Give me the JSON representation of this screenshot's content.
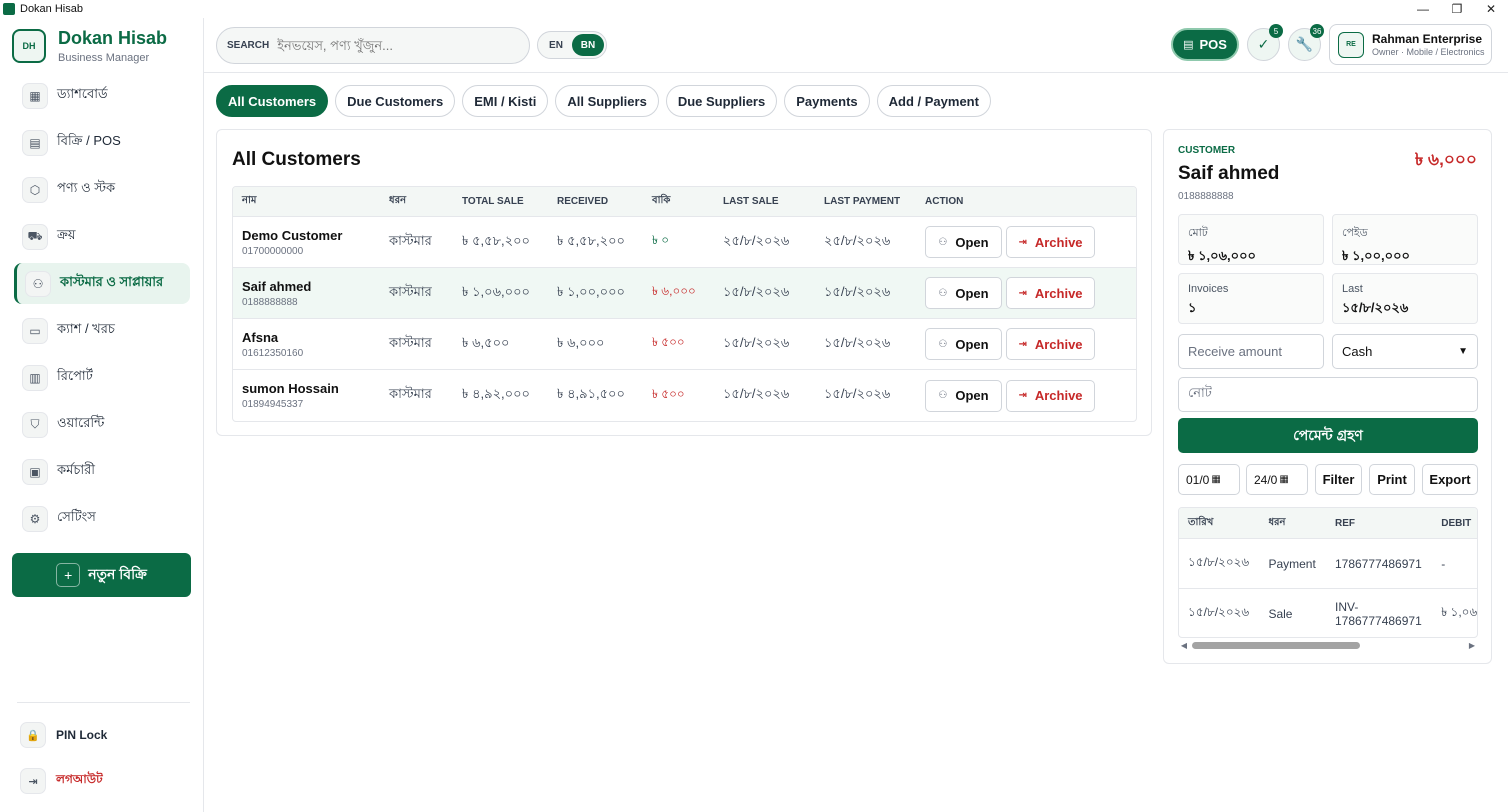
{
  "window": {
    "title": "Dokan Hisab",
    "minimize": "—",
    "maximize": "❐",
    "close": "✕"
  },
  "brand": {
    "title": "Dokan Hisab",
    "subtitle": "Business Manager",
    "logo_text": "DH"
  },
  "sidebar": {
    "items": [
      {
        "label": "ড্যাশবোর্ড",
        "icon": "dashboard-icon",
        "glyph": "▦"
      },
      {
        "label": "বিক্রি / POS",
        "icon": "receipt-icon",
        "glyph": "▤"
      },
      {
        "label": "পণ্য ও স্টক",
        "icon": "box-icon",
        "glyph": "⬡"
      },
      {
        "label": "ক্রয়",
        "icon": "truck-icon",
        "glyph": "⛟"
      },
      {
        "label": "কাস্টমার ও সাপ্লায়ার",
        "icon": "users-icon",
        "glyph": "⚇"
      },
      {
        "label": "ক্যাশ / খরচ",
        "icon": "wallet-icon",
        "glyph": "▭"
      },
      {
        "label": "রিপোর্ট",
        "icon": "bar-chart-icon",
        "glyph": "▥"
      },
      {
        "label": "ওয়ারেন্টি",
        "icon": "shield-icon",
        "glyph": "⛉"
      },
      {
        "label": "কর্মচারী",
        "icon": "calendar-icon",
        "glyph": "▣"
      },
      {
        "label": "সেটিংস",
        "icon": "gear-icon",
        "glyph": "⚙"
      }
    ],
    "active_index": 4,
    "new_sale_label": "নতুন বিক্রি",
    "new_sale_plus": "+",
    "pin_lock": "PIN Lock",
    "lock_glyph": "🔒",
    "logout": "লগআউট",
    "logout_glyph": "⇥"
  },
  "topbar": {
    "search_label": "SEARCH",
    "search_placeholder": "ইনভয়েস, পণ্য খুঁজুন...",
    "lang_en": "EN",
    "lang_bn": "BN",
    "pos_label": "POS",
    "warranty_badge": "5",
    "tools_badge": "36",
    "profile_name": "Rahman Enterprise",
    "profile_sub": "Owner · Mobile / Electronics",
    "avatar_text": "RE"
  },
  "tabs": [
    "All Customers",
    "Due Customers",
    "EMI / Kisti",
    "All Suppliers",
    "Due Suppliers",
    "Payments",
    "Add / Payment"
  ],
  "customers": {
    "title": "All Customers",
    "columns": [
      "নাম",
      "ধরন",
      "TOTAL SALE",
      "RECEIVED",
      "বাকি",
      "LAST SALE",
      "LAST PAYMENT",
      "ACTION"
    ],
    "open_label": "Open",
    "archive_label": "Archive",
    "rows": [
      {
        "name": "Demo Customer",
        "phone": "01700000000",
        "type": "কাস্টমার",
        "total": "৳ ৫,৫৮,২০০",
        "received": "৳ ৫,৫৮,২০০",
        "due": "৳ ০",
        "last_sale": "২৫/৮/২০২৬",
        "last_payment": "২৫/৮/২০২৬"
      },
      {
        "name": "Saif ahmed",
        "phone": "0188888888",
        "type": "কাস্টমার",
        "total": "৳ ১,০৬,০০০",
        "received": "৳ ১,০০,০০০",
        "due": "৳ ৬,০০০",
        "last_sale": "১৫/৮/২০২৬",
        "last_payment": "১৫/৮/২০২৬"
      },
      {
        "name": "Afsna",
        "phone": "01612350160",
        "type": "কাস্টমার",
        "total": "৳ ৬,৫০০",
        "received": "৳ ৬,০০০",
        "due": "৳ ৫০০",
        "last_sale": "১৫/৮/২০২৬",
        "last_payment": "১৫/৮/২০২৬"
      },
      {
        "name": "sumon Hossain",
        "phone": "01894945337",
        "type": "কাস্টমার",
        "total": "৳ ৪,৯২,০০০",
        "received": "৳ ৪,৯১,৫০০",
        "due": "৳ ৫০০",
        "last_sale": "১৫/৮/২০২৬",
        "last_payment": "১৫/৮/২০২৬"
      }
    ]
  },
  "detail": {
    "label": "CUSTOMER",
    "name": "Saif ahmed",
    "phone": "0188888888",
    "due_amount": "৳ ৬,০০০",
    "total_label": "মোট",
    "total_value": "৳ ১,০৬,০০০",
    "paid_label": "পেইড",
    "paid_value": "৳ ১,০০,০০০",
    "invoices_label": "Invoices",
    "invoices_value": "১",
    "last_label": "Last",
    "last_value": "১৫/৮/২০২৬",
    "receive_placeholder": "Receive amount",
    "method": "Cash",
    "note_placeholder": "নোট",
    "pay_button": "পেমেন্ট গ্রহণ",
    "date_from": "01/0",
    "date_to": "24/0",
    "filter": "Filter",
    "print": "Print",
    "export": "Export",
    "ledger_columns": [
      "তারিখ",
      "ধরন",
      "REF",
      "DEBIT"
    ],
    "ledger_rows": [
      {
        "date": "১৫/৮/২০২৬",
        "type": "Payment",
        "ref": "1786777486971",
        "debit": "-"
      },
      {
        "date": "১৫/৮/২০২৬",
        "type": "Sale",
        "ref": "INV-1786777486971",
        "debit": "৳ ১,০৬"
      }
    ]
  },
  "colors": {
    "brand": "#0b6b45",
    "due": "#c62828",
    "zero_due": "#0b6b45"
  }
}
